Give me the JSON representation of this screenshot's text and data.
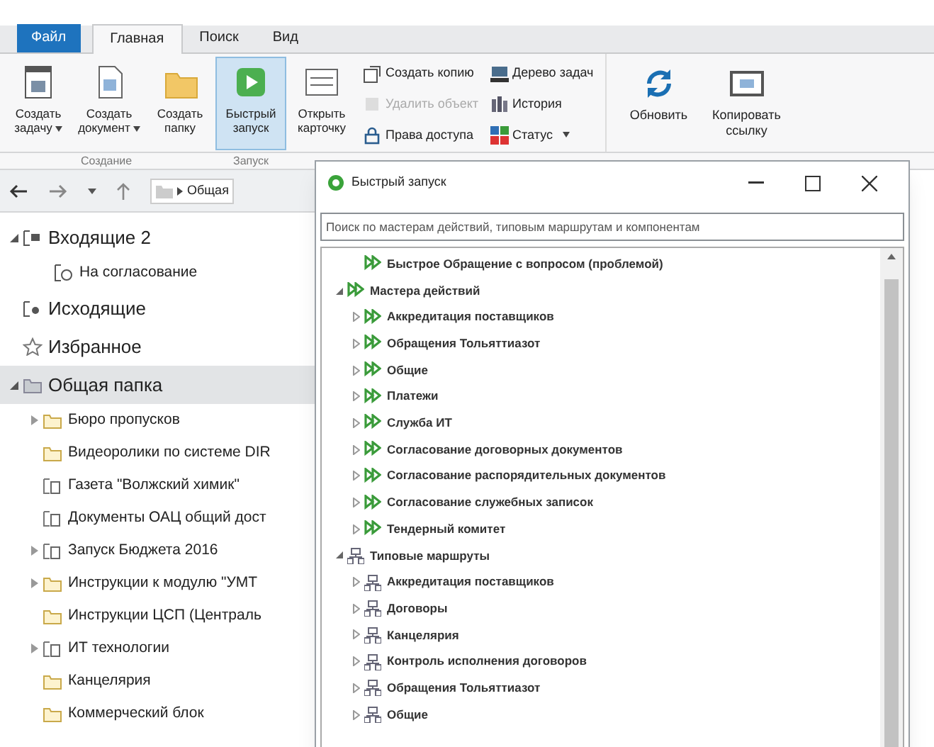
{
  "ribbon": {
    "tabs": [
      {
        "label": "Файл",
        "kind": "file",
        "selected": false
      },
      {
        "label": "Главная",
        "kind": "tab",
        "selected": true
      },
      {
        "label": "Поиск",
        "kind": "tab",
        "selected": false
      },
      {
        "label": "Вид",
        "kind": "tab",
        "selected": false
      }
    ],
    "large_buttons": [
      {
        "label": "Создать задачу",
        "kind": "task",
        "dropdown": true,
        "selected": false
      },
      {
        "label": "Создать документ",
        "kind": "document",
        "dropdown": true,
        "selected": false
      },
      {
        "label": "Создать папку",
        "kind": "folder",
        "dropdown": false,
        "selected": false
      },
      {
        "label": "Быстрый запуск",
        "kind": "play",
        "dropdown": false,
        "selected": true
      },
      {
        "label": "Открыть карточку",
        "kind": "card",
        "dropdown": false,
        "selected": false
      }
    ],
    "small_buttons": [
      {
        "label": "Создать копию",
        "kind": "copy",
        "disabled": false
      },
      {
        "label": "Удалить объект",
        "kind": "delete",
        "disabled": true
      },
      {
        "label": "Права доступа",
        "kind": "lock",
        "disabled": false
      },
      {
        "label": "Дерево задач",
        "kind": "tree",
        "disabled": false
      },
      {
        "label": "История",
        "kind": "history",
        "disabled": false
      },
      {
        "label": "Статус",
        "kind": "status",
        "disabled": false,
        "dropdown": true
      }
    ],
    "right_buttons": [
      {
        "label": "Обновить",
        "kind": "refresh"
      },
      {
        "label": "Копировать ссылку",
        "kind": "link"
      }
    ],
    "group_labels": [
      "Создание",
      "Запуск"
    ]
  },
  "navigation": {
    "path": "Общая"
  },
  "folders": [
    {
      "label": "Входящие 2",
      "kind": "inbox",
      "expanded": true,
      "selected": false,
      "children": [
        {
          "label": "На согласование",
          "kind": "approval"
        }
      ]
    },
    {
      "label": "Исходящие",
      "kind": "outbox"
    },
    {
      "label": "Избранное",
      "kind": "star"
    },
    {
      "label": "Общая папка",
      "kind": "shared",
      "expanded": true,
      "selected": true,
      "children": [
        {
          "label": "Бюро пропусков",
          "kind": "folder",
          "expanded": false
        },
        {
          "label": "Видеоролики по системе DIR",
          "kind": "folder"
        },
        {
          "label": "Газета \"Волжский химик\"",
          "kind": "doc-folder"
        },
        {
          "label": "Документы ОАЦ общий дост",
          "kind": "doc-folder"
        },
        {
          "label": "Запуск Бюджета 2016",
          "kind": "doc-folder",
          "expanded": false
        },
        {
          "label": "Инструкции к модулю \"УМТ",
          "kind": "folder",
          "expanded": false
        },
        {
          "label": "Инструкции ЦСП (Централь",
          "kind": "folder"
        },
        {
          "label": "ИТ технологии",
          "kind": "doc-folder",
          "expanded": false
        },
        {
          "label": "Канцелярия",
          "kind": "folder"
        },
        {
          "label": "Коммерческий блок",
          "kind": "folder"
        }
      ]
    }
  ],
  "dialog": {
    "title": "Быстрый запуск",
    "search": {
      "placeholder": "Поиск по мастерам действий, типовым маршрутам и компонентам"
    },
    "tree": [
      {
        "label": "Быстрое Обращение с вопросом (проблемой)",
        "kind": "wizard"
      },
      {
        "label": "Мастера действий",
        "kind": "wizard",
        "expanded": true,
        "children": [
          {
            "label": "Аккредитация поставщиков",
            "kind": "wizard",
            "expanded": false
          },
          {
            "label": "Обращения Тольяттиазот",
            "kind": "wizard",
            "expanded": false
          },
          {
            "label": "Общие",
            "kind": "wizard",
            "expanded": false
          },
          {
            "label": "Платежи",
            "kind": "wizard",
            "expanded": false
          },
          {
            "label": "Служба ИТ",
            "kind": "wizard",
            "expanded": false
          },
          {
            "label": "Согласование договорных документов",
            "kind": "wizard",
            "expanded": false
          },
          {
            "label": "Согласование распорядительных документов",
            "kind": "wizard",
            "expanded": false
          },
          {
            "label": "Согласование служебных записок",
            "kind": "wizard",
            "expanded": false
          },
          {
            "label": "Тендерный комитет",
            "kind": "wizard",
            "expanded": false
          }
        ]
      },
      {
        "label": "Типовые маршруты",
        "kind": "route",
        "expanded": true,
        "children": [
          {
            "label": "Аккредитация поставщиков",
            "kind": "route",
            "expanded": false
          },
          {
            "label": "Договоры",
            "kind": "route",
            "expanded": false
          },
          {
            "label": "Канцелярия",
            "kind": "route",
            "expanded": false
          },
          {
            "label": "Контроль исполнения договоров",
            "kind": "route",
            "expanded": false
          },
          {
            "label": "Обращения Тольяттиазот",
            "kind": "route",
            "expanded": false
          },
          {
            "label": "Общие",
            "kind": "route",
            "expanded": false
          }
        ]
      }
    ]
  }
}
